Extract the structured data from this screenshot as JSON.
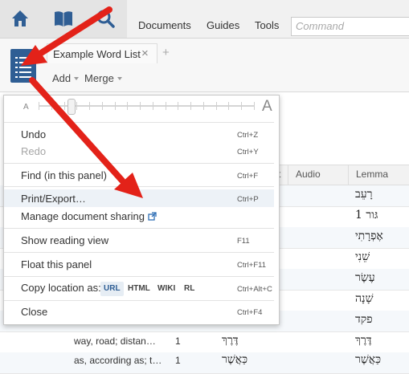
{
  "topnav": {
    "links": [
      "Documents",
      "Guides",
      "Tools"
    ],
    "command_placeholder": "Command"
  },
  "panel": {
    "tab_title": "Example Word List",
    "tab_close": "×",
    "tab_add": "+",
    "toolbar": {
      "add": "Add",
      "merge": "Merge"
    }
  },
  "menu": {
    "font_small": "A",
    "font_large": "A",
    "font_size_level": 0.15,
    "items": [
      {
        "label": "Undo",
        "shortcut": "Ctrl+Z",
        "enabled": true
      },
      {
        "label": "Redo",
        "shortcut": "Ctrl+Y",
        "enabled": false
      },
      {
        "label": "Find (in this panel)",
        "shortcut": "Ctrl+F",
        "enabled": true
      },
      {
        "label": "Print/Export…",
        "shortcut": "Ctrl+P",
        "enabled": true
      },
      {
        "label": "Manage document sharing",
        "shortcut": "",
        "enabled": true
      },
      {
        "label": "Show reading view",
        "shortcut": "F11",
        "enabled": true
      },
      {
        "label": "Float this panel",
        "shortcut": "Ctrl+F11",
        "enabled": true
      },
      {
        "label": "Copy location as:",
        "shortcut": "Ctrl+Alt+C",
        "enabled": true
      },
      {
        "label": "Close",
        "shortcut": "Ctrl+F4",
        "enabled": true
      }
    ],
    "copy_formats": [
      "URL",
      "HTML",
      "WIKI",
      "RL"
    ]
  },
  "table": {
    "headers": {
      "partial": "t",
      "audio": "Audio",
      "lemma": "Lemma"
    },
    "lemmas": [
      "רָעֵב",
      "גּור 1",
      "אֶפְרָתִי",
      "שֵׁנִי",
      "עֶשֶׂר",
      "שָׁנָה",
      "פקד",
      "דֶּרֶךְ",
      "כַּאֲשֶׁר"
    ],
    "bottom_rows": [
      {
        "gloss": "way, road; distan…",
        "count": "1",
        "word": "דֶּרֶךְ"
      },
      {
        "gloss": "as, according as; t…",
        "count": "1",
        "word": "כַּאֲשֶׁר"
      }
    ]
  }
}
